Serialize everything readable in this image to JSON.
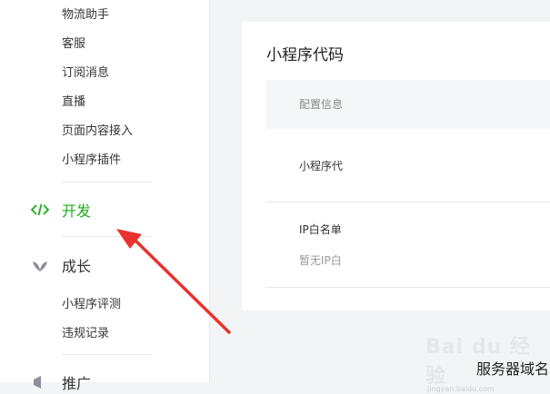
{
  "sidebar": {
    "group1": [
      "物流助手",
      "客服",
      "订阅消息",
      "直播",
      "页面内容接入",
      "小程序插件"
    ],
    "dev": {
      "label": "开发",
      "icon": "code-icon"
    },
    "growth": {
      "label": "成长",
      "icon": "sprout-icon"
    },
    "group2": [
      "小程序评测",
      "违规记录"
    ],
    "promo": {
      "label": "推广",
      "icon": "megaphone-icon"
    }
  },
  "main": {
    "card": {
      "title": "小程序代码",
      "config_label": "配置信息",
      "row1_label": "小程序代",
      "row2_label": "IP白名单",
      "row2_value": "暂无IP白"
    },
    "card2_title": "服务器域名"
  },
  "watermark": {
    "text": "Bai du 经验",
    "sub": "jingyan.baidu.com"
  },
  "colors": {
    "accent": "#1aad19",
    "arrow": "#e8322d"
  }
}
